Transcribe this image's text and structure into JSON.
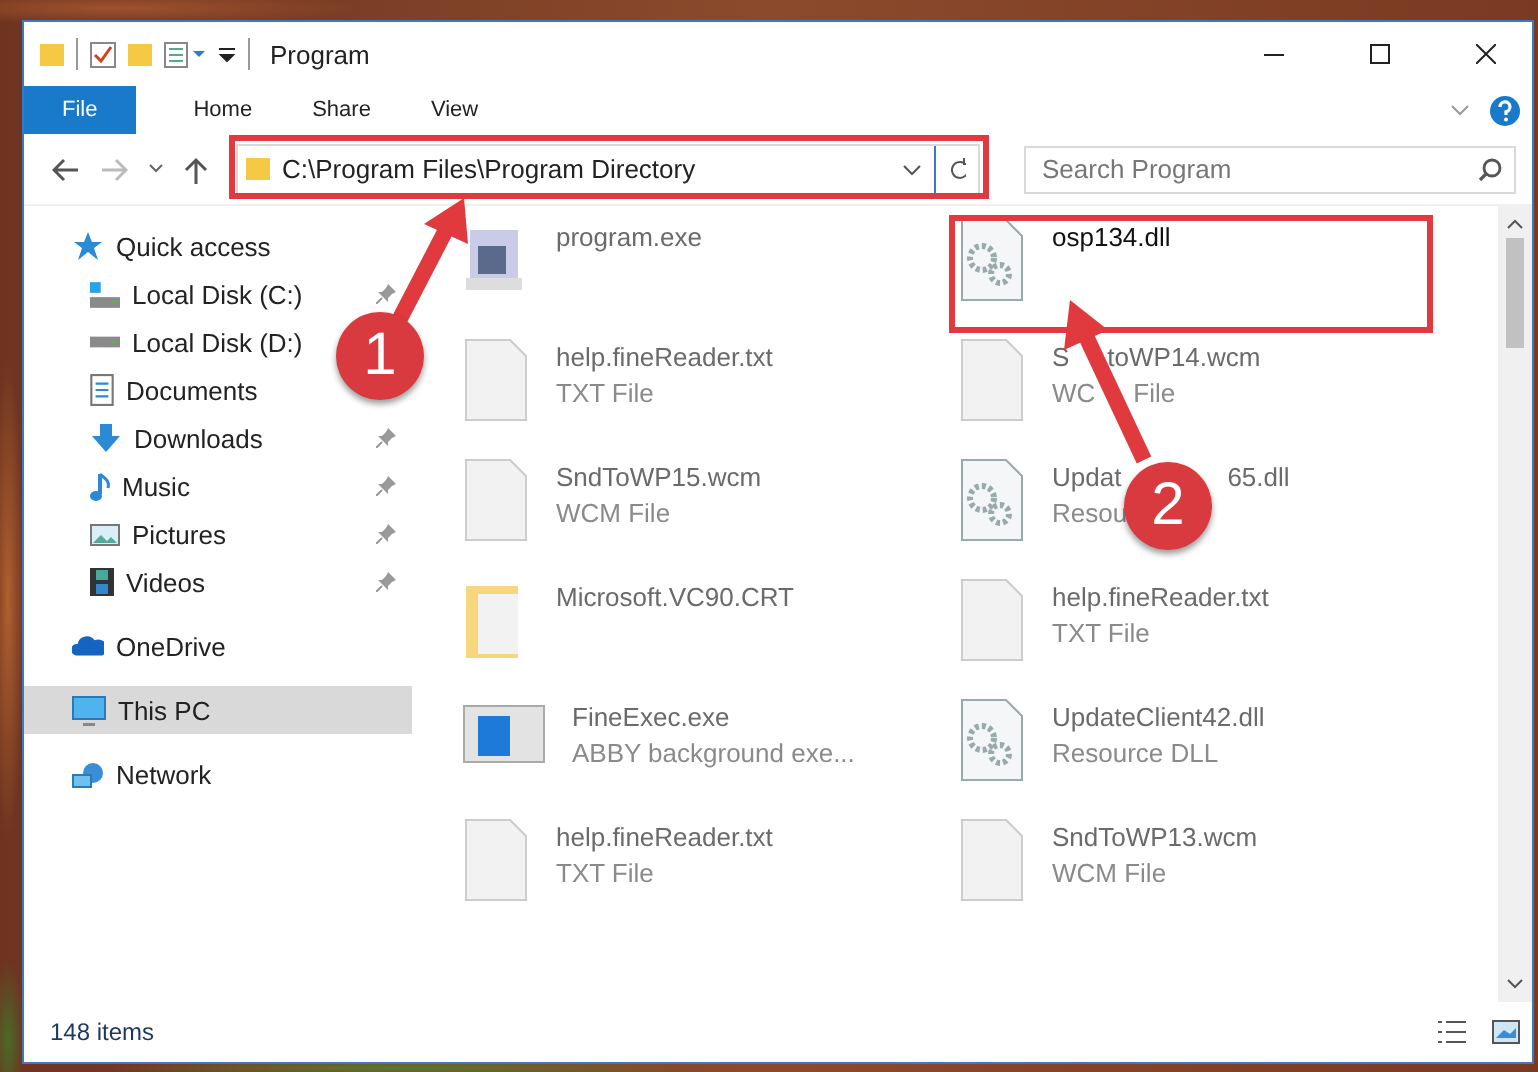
{
  "window": {
    "title": "Program"
  },
  "ribbon_tabs": [
    {
      "label": "File",
      "kind": "file"
    },
    {
      "label": "Home",
      "kind": "tab"
    },
    {
      "label": "Share",
      "kind": "tab"
    },
    {
      "label": "View",
      "kind": "tab"
    }
  ],
  "address": {
    "path": "C:\\Program Files\\Program Directory"
  },
  "search": {
    "placeholder": "Search Program"
  },
  "sidebar": {
    "items": [
      {
        "label": "Quick access",
        "kind": "star",
        "selected": false,
        "children": [
          {
            "label": "Local Disk (C:)",
            "kind": "disk-c",
            "pinned": true
          },
          {
            "label": "Local Disk (D:)",
            "kind": "disk",
            "pinned": false
          },
          {
            "label": "Documents",
            "kind": "documents",
            "pinned": false
          },
          {
            "label": "Downloads",
            "kind": "downloads",
            "pinned": true
          },
          {
            "label": "Music",
            "kind": "music",
            "pinned": true
          },
          {
            "label": "Pictures",
            "kind": "pictures",
            "pinned": true
          },
          {
            "label": "Videos",
            "kind": "videos",
            "pinned": true
          }
        ]
      },
      {
        "label": "OneDrive",
        "kind": "cloud",
        "selected": false
      },
      {
        "label": "This PC",
        "kind": "pc",
        "selected": true
      },
      {
        "label": "Network",
        "kind": "network",
        "selected": false
      }
    ]
  },
  "files": [
    {
      "name": "program.exe",
      "kind": "installer",
      "blurred": true
    },
    {
      "name": "osp134.dll",
      "kind": "dll",
      "blurred": false
    },
    {
      "name": "help.fineReader.txt",
      "type": "TXT File",
      "kind": "blank",
      "blurred": true
    },
    {
      "name": "S",
      "name_tail": "toWP14.wcm",
      "type": "WC",
      "type_tail": "File",
      "under_circle": false,
      "kind": "blank",
      "blurred": true
    },
    {
      "name": "SndToWP15.wcm",
      "type": "WCM File",
      "kind": "blank",
      "blurred": true
    },
    {
      "name": "Updat",
      "name_tail": "65.dll",
      "type": "Resou",
      "under_circle": true,
      "kind": "dll",
      "blurred": true
    },
    {
      "name": "Microsoft.VC90.CRT",
      "kind": "folder",
      "blurred": true
    },
    {
      "name": "help.fineReader.txt",
      "type": "TXT File",
      "kind": "blank",
      "blurred": true
    },
    {
      "name": "FineExec.exe",
      "type": "ABBY background exe...",
      "kind": "app",
      "blurred": true
    },
    {
      "name": "UpdateClient42.dll",
      "type": "Resource DLL",
      "kind": "dll",
      "blurred": true
    },
    {
      "name": "help.fineReader.txt",
      "type": "TXT File",
      "kind": "blank",
      "blurred": true
    },
    {
      "name": "SndToWP13.wcm",
      "type": "WCM File",
      "kind": "blank",
      "blurred": true
    }
  ],
  "status_bar": {
    "count": "148 items"
  },
  "annotations": [
    {
      "number": "1"
    },
    {
      "number": "2"
    }
  ]
}
